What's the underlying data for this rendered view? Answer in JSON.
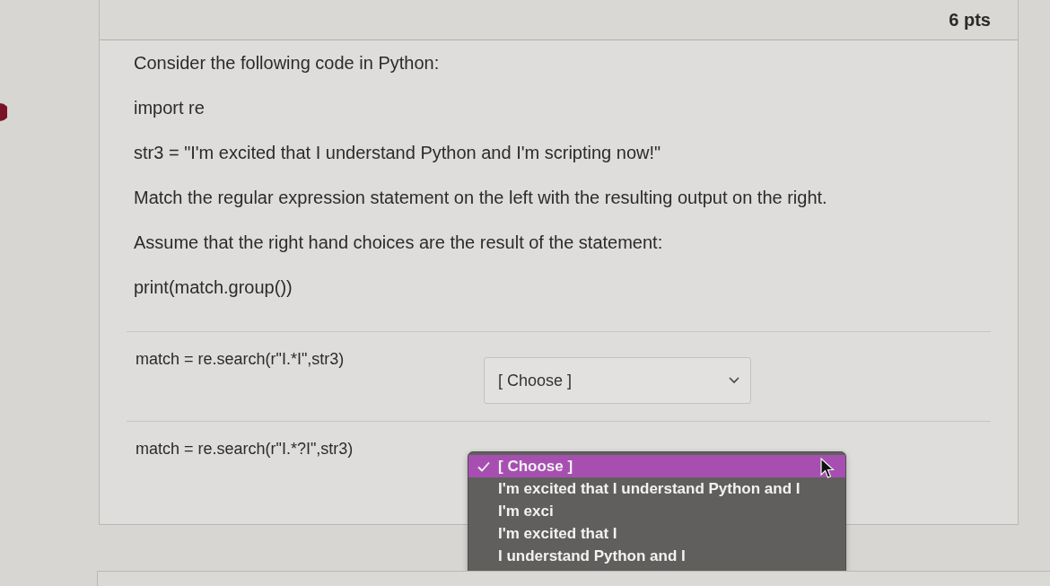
{
  "question": {
    "points": "6 pts",
    "paragraphs": [
      "Consider the following code in Python:",
      "import re",
      "str3 = \"I'm excited that I understand Python and I'm scripting now!\"",
      "Match the regular expression statement on the left with the resulting output on the right.",
      "Assume that the right hand choices are the result of the statement:",
      "print(match.group())"
    ],
    "matches": [
      {
        "statement": "match = re.search(r\"I.*I\",str3)",
        "answer": {
          "value": "[ Choose ]",
          "open": false
        }
      },
      {
        "statement": "match = re.search(r\"I.*?I\",str3)",
        "answer": {
          "open": true,
          "options": [
            {
              "label": "[ Choose ]",
              "selected": true
            },
            {
              "label": "I'm excited that I understand Python and I",
              "selected": false
            },
            {
              "label": "I'm exci",
              "selected": false
            },
            {
              "label": "I'm excited that I",
              "selected": false
            },
            {
              "label": "I understand Python and I",
              "selected": false
            }
          ]
        }
      }
    ]
  }
}
